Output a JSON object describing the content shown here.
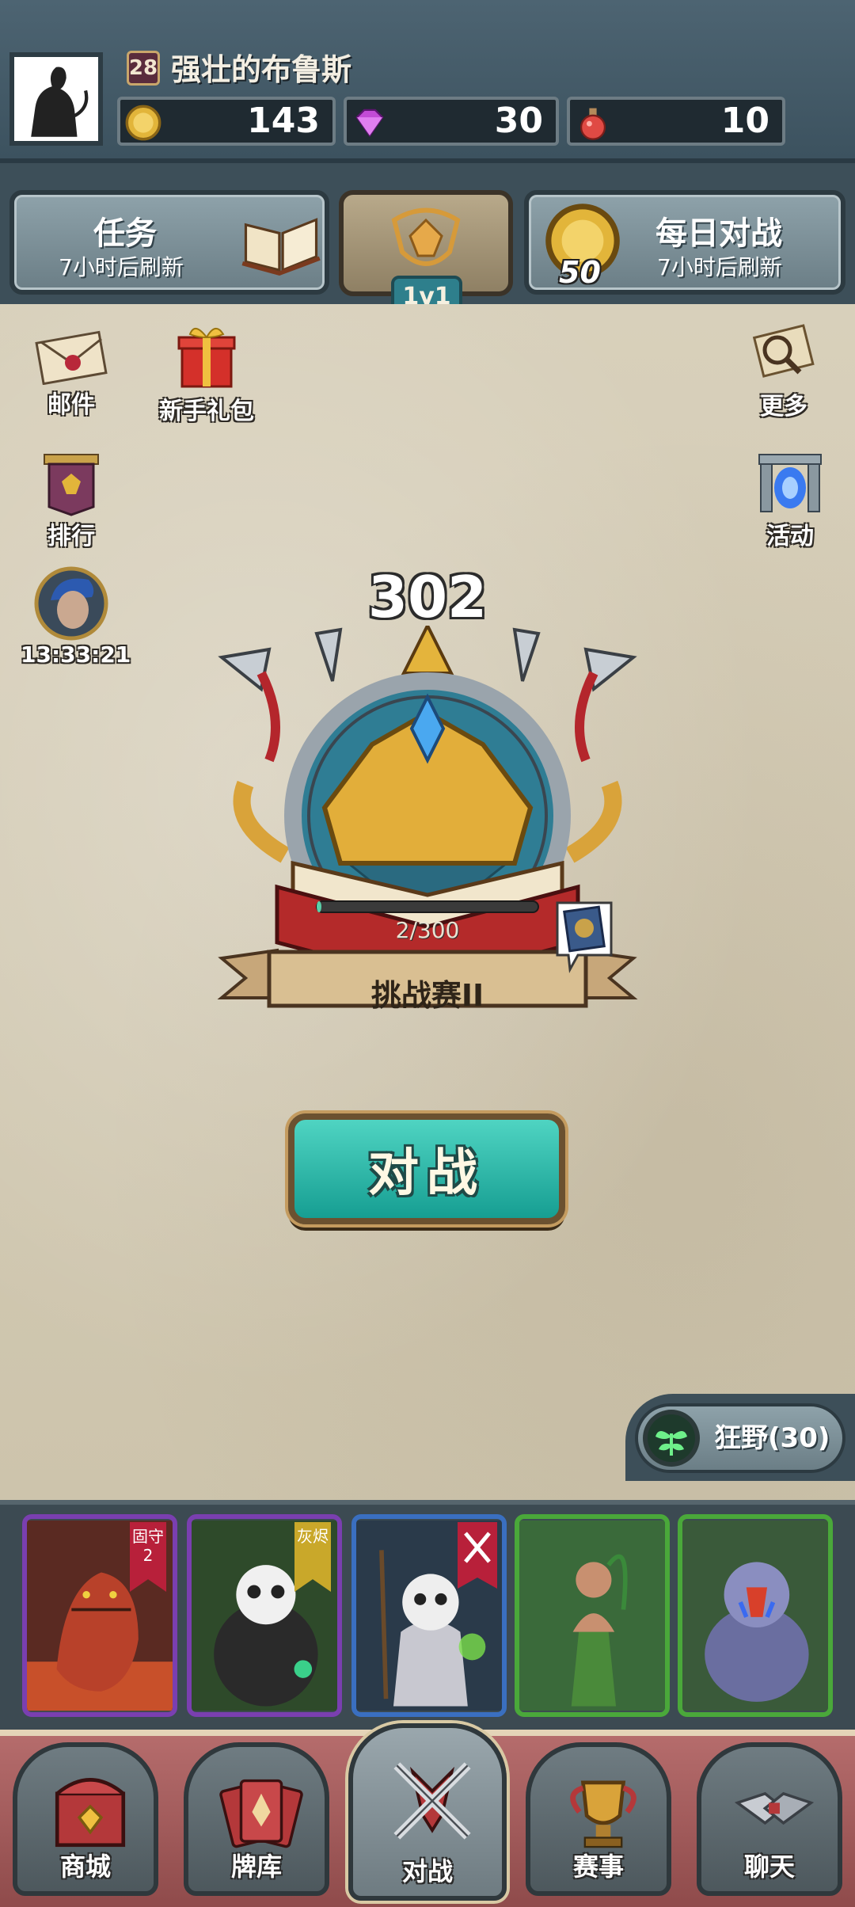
{
  "player": {
    "level": "28",
    "name": "强壮的布鲁斯"
  },
  "resources": {
    "gold": "143",
    "gems": "30",
    "potions": "10"
  },
  "top_buttons": {
    "tasks": {
      "title": "任务",
      "subtitle": "7小时后刷新"
    },
    "mode": {
      "tag": "1v1"
    },
    "daily_battle": {
      "title": "每日对战",
      "subtitle": "7小时后刷新",
      "coin_amount": "50"
    }
  },
  "side_left": {
    "mail": "邮件",
    "starter_pack": "新手礼包",
    "rank": "排行",
    "timer": "13:33:21"
  },
  "side_right": {
    "more": "更多",
    "events": "活动"
  },
  "rank": {
    "score": "302",
    "progress": "2/300",
    "progress_value": 2,
    "progress_max": 300,
    "tier_name": "挑战赛II"
  },
  "battle_button": "对战",
  "deck": {
    "label": "狂野(30)"
  },
  "cards": [
    {
      "name": "tiger-card",
      "frame_color": "#7a3fb0",
      "ribbon": "固守2",
      "ribbon_color": "#b8203a"
    },
    {
      "name": "panda-warrior-card",
      "frame_color": "#7a3fb0",
      "ribbon": "灰烬",
      "ribbon_color": "#c9a82a"
    },
    {
      "name": "panda-shaman-card",
      "frame_color": "#3a6fc0",
      "ribbon": "",
      "ribbon_color": "#b8203a"
    },
    {
      "name": "jungle-hero-card",
      "frame_color": "#4aa83a",
      "ribbon": "",
      "ribbon_color": ""
    },
    {
      "name": "mandrill-card",
      "frame_color": "#4aa83a",
      "ribbon": "",
      "ribbon_color": ""
    }
  ],
  "nav": {
    "shop": "商城",
    "deck": "牌库",
    "battle": "对战",
    "events": "赛事",
    "chat": "聊天"
  },
  "colors": {
    "header_bg": "#4d6472",
    "battle_button": "#2cb8aa",
    "nav_bg": "#a55e5e"
  }
}
